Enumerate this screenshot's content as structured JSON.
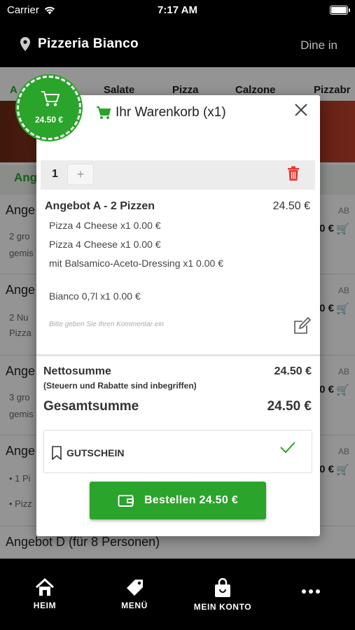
{
  "status_bar": {
    "carrier": "Carrier",
    "time": "7:17 AM"
  },
  "header": {
    "restaurant": "Pizzeria Bianco",
    "mode": "Dine in"
  },
  "tabs": [
    "A",
    "Salate",
    "Pizza",
    "Calzone",
    "Pizzabr"
  ],
  "section_title": "Ang",
  "background_items": [
    {
      "title": "Ange",
      "desc": [
        "2 gro",
        "gemis"
      ],
      "ab": "AB",
      "price": "0 €"
    },
    {
      "title": "Ange",
      "desc": [
        "2 Nu",
        "Pizza"
      ],
      "ab": "AB",
      "price": "0 €"
    },
    {
      "title": "Ange",
      "desc": [
        "3 gro",
        "gemis"
      ],
      "ab": "AB",
      "price": "0 €"
    },
    {
      "title": "Ange",
      "desc": [
        "• 1 Pi",
        "• Pizz"
      ],
      "ab": "AB",
      "price": "0 €"
    },
    {
      "title": "Angebot D (für 8 Personen)"
    }
  ],
  "cart": {
    "title": "Ihr Warenkorb (x1)",
    "badge_total": "24.50 €",
    "quantity": "1",
    "plus_label": "+",
    "item_name": "Angebot A - 2 Pizzen",
    "item_price": "24.50 €",
    "sub_items": [
      "Pizza 4 Cheese x1 0.00 €",
      "Pizza 4 Cheese x1 0.00 €",
      "mit Balsamico-Aceto-Dressing x1 0.00 €",
      "Bianco 0,7l x1 0.00 €"
    ],
    "comment_placeholder": "Bitte geben Sie Ihren Kommentar ein",
    "net_label": "Nettosumme",
    "net_value": "24.50 €",
    "net_note": "(Steuern und Rabatte sind inbegriffen)",
    "total_label": "Gesamtsumme",
    "total_value": "24.50 €",
    "coupon_label": "GUTSCHEIN",
    "order_button": "Bestellen 24.50 €"
  },
  "nav": {
    "home": "HEIM",
    "menu": "MENÜ",
    "account": "MEIN KONTO"
  },
  "colors": {
    "accent": "#2aa42a",
    "danger": "#e53935"
  }
}
